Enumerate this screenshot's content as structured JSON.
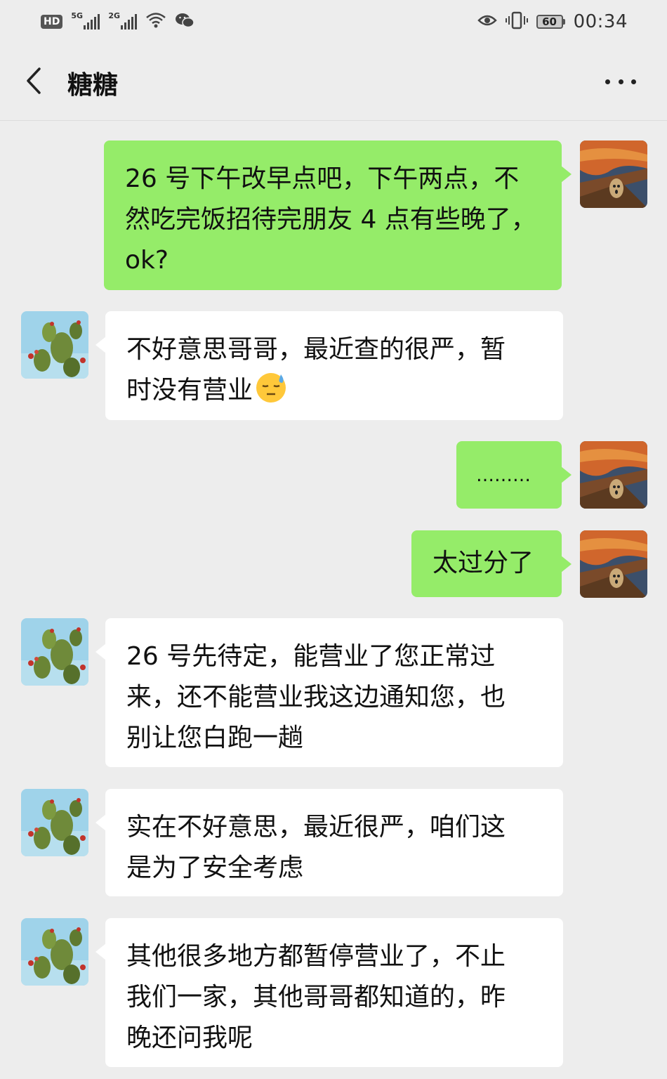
{
  "status_bar": {
    "hd": "HD",
    "sim1_net": "5G",
    "sim2_net": "2G",
    "battery": "60",
    "time": "00:34"
  },
  "header": {
    "title": "糖糖",
    "back_icon": "chevron-left-icon",
    "more_icon": "more-dots-icon"
  },
  "messages": [
    {
      "from": "me",
      "text": "26 号下午改早点吧，下午两点，不\n然吃完饭招待完朋友 4 点有些晚了，\nok?"
    },
    {
      "from": "them",
      "text": "不好意思哥哥，最近查的很严，暂\n时没有营业",
      "emoji": "downcast-sweat-face"
    },
    {
      "from": "me",
      "text": "………"
    },
    {
      "from": "me",
      "text": "太过分了"
    },
    {
      "from": "them",
      "text": "26 号先待定，能营业了您正常过\n来，还不能营业我这边通知您，也\n别让您白跑一趟"
    },
    {
      "from": "them",
      "text": "实在不好意思，最近很严，咱们这\n是为了安全考虑"
    },
    {
      "from": "them",
      "text": "其他很多地方都暂停营业了，不止\n我们一家，其他哥哥都知道的，昨\n晚还问我呢"
    }
  ],
  "colors": {
    "background": "#ededed",
    "my_bubble": "#95ec69",
    "their_bubble": "#ffffff"
  }
}
